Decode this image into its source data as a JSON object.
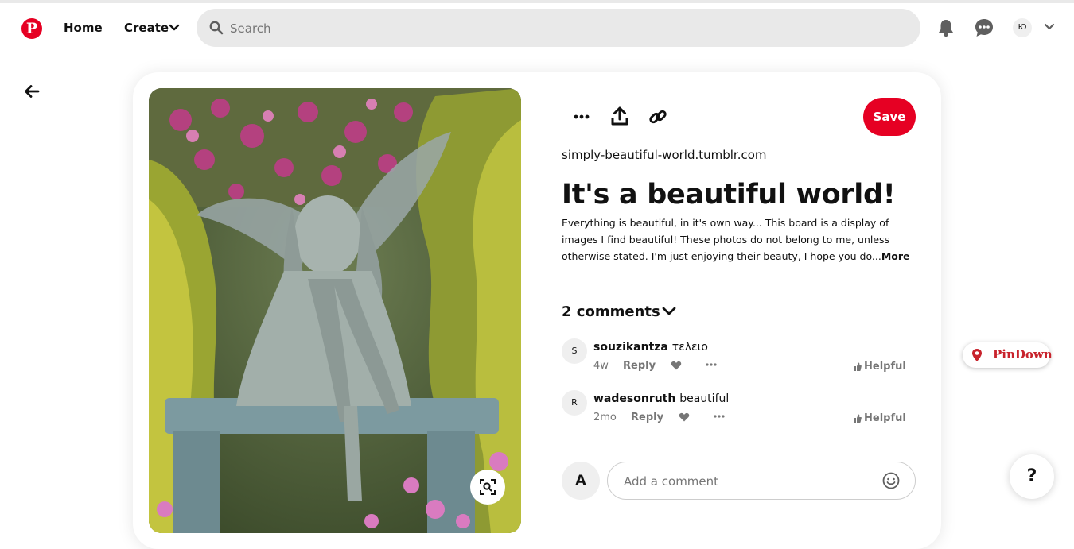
{
  "header": {
    "logo_letter": "P",
    "home_label": "Home",
    "create_label": "Create",
    "search_placeholder": "Search",
    "avatar_initial": "Ю"
  },
  "pin": {
    "source_link": "simply-beautiful-world.tumblr.com",
    "title": "It's a beautiful world!",
    "description": "Everything is beautiful, in it's own way... This board is a display of images I find beautiful! These photos do not belong to me, unless otherwise stated. I'm just enjoying their beauty, I hope you do...",
    "more_label": "More",
    "save_label": "Save"
  },
  "comments": {
    "heading": "2 comments",
    "items": [
      {
        "avatar": "S",
        "user": "souzikantza",
        "text": "τελειο",
        "time": "4w",
        "reply_label": "Reply",
        "helpful_label": "Helpful"
      },
      {
        "avatar": "R",
        "user": "wadesonruth",
        "text": "beautiful",
        "time": "2mo",
        "reply_label": "Reply",
        "helpful_label": "Helpful"
      }
    ],
    "my_avatar": "A",
    "add_placeholder": "Add a comment"
  },
  "extension": {
    "label": "PinDown"
  },
  "help_label": "?",
  "colors": {
    "brand_red": "#e60023",
    "pindown_red": "#c8232c",
    "search_bg": "#e9e9e9"
  },
  "icons": [
    "pinterest-logo",
    "chevron-down-icon",
    "search-icon",
    "bell-icon",
    "messages-icon",
    "back-arrow-icon",
    "more-dots-icon",
    "share-icon",
    "link-icon",
    "heart-icon",
    "thumb-icon",
    "emoji-icon",
    "lens-icon",
    "map-pin-icon"
  ]
}
